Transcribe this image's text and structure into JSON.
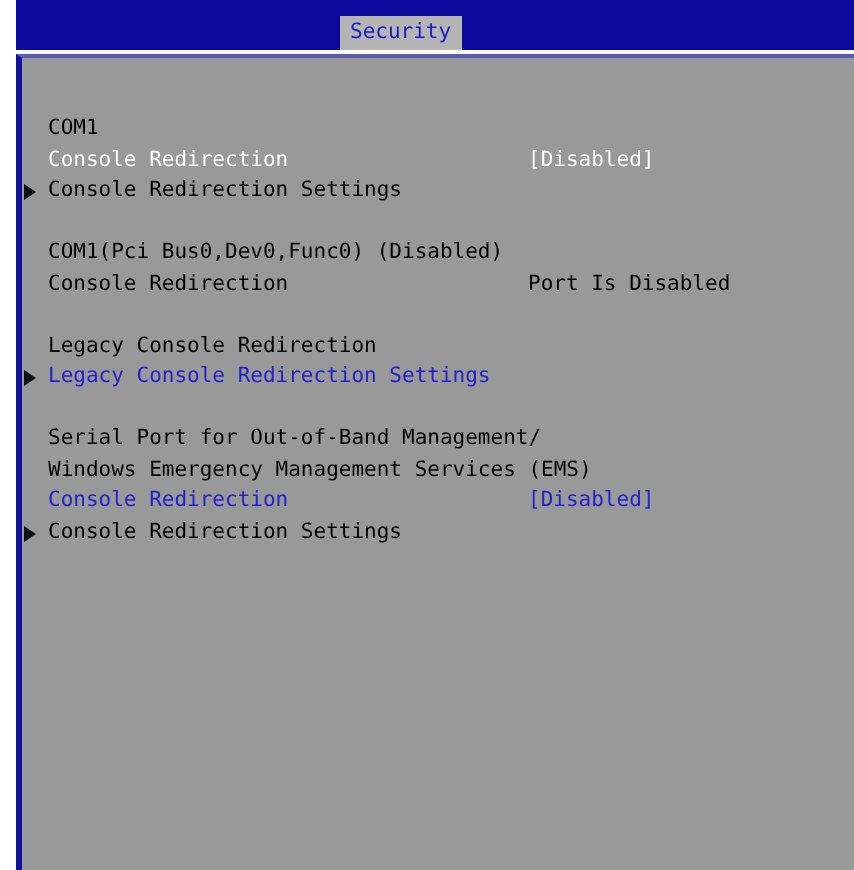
{
  "tabs": [
    {
      "label": "Security",
      "selected": true
    }
  ],
  "groups": [
    {
      "rows": [
        {
          "kind": "heading",
          "label": "COM1",
          "color": "#000000"
        },
        {
          "kind": "option",
          "label": "Console Redirection",
          "value": "[Disabled]",
          "color": "#ffffff"
        },
        {
          "kind": "submenu",
          "label": "Console Redirection Settings",
          "color": "#000000"
        }
      ]
    },
    {
      "rows": [
        {
          "kind": "heading",
          "label": "COM1(Pci Bus0,Dev0,Func0) (Disabled)",
          "color": "#000000"
        },
        {
          "kind": "option",
          "label": "Console Redirection",
          "value": "Port Is Disabled",
          "color": "#000000"
        }
      ]
    },
    {
      "rows": [
        {
          "kind": "heading",
          "label": "Legacy Console Redirection",
          "color": "#000000"
        },
        {
          "kind": "submenu",
          "label": "Legacy Console Redirection Settings",
          "color": "#2222cc"
        }
      ]
    },
    {
      "rows": [
        {
          "kind": "heading",
          "label": "Serial Port for Out-of-Band Management/",
          "color": "#000000"
        },
        {
          "kind": "heading",
          "label": "Windows Emergency Management Services (EMS)",
          "color": "#000000"
        },
        {
          "kind": "option",
          "label": "Console Redirection",
          "value": "[Disabled]",
          "color": "#2222cc"
        },
        {
          "kind": "submenu",
          "label": "Console Redirection Settings",
          "color": "#000000"
        }
      ]
    }
  ]
}
